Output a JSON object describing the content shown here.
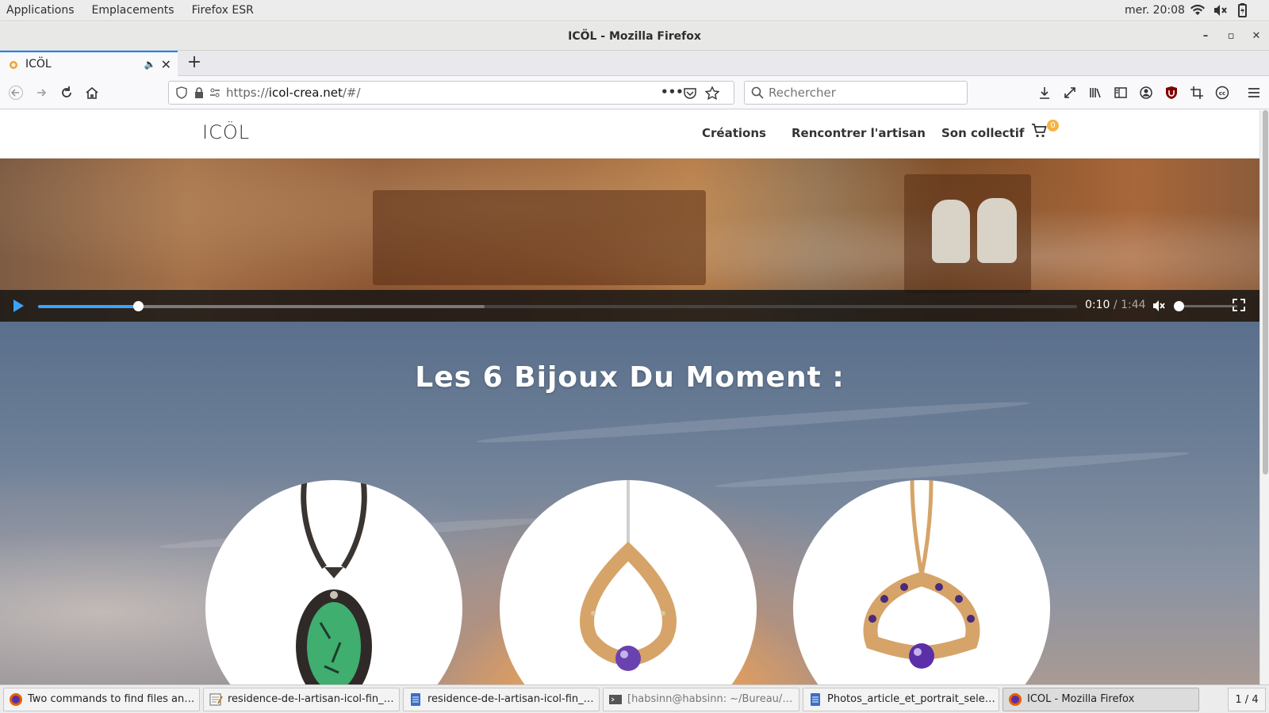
{
  "system_panel": {
    "menus": [
      "Applications",
      "Emplacements",
      "Firefox ESR"
    ],
    "clock": "mer. 20:08"
  },
  "window": {
    "title": "ICÖL - Mozilla Firefox"
  },
  "browser": {
    "tab_title": "ICÖL",
    "url_prefix": "https://",
    "url_domain": "icol-crea.net",
    "url_path": "/#/",
    "search_placeholder": "Rechercher"
  },
  "site": {
    "logo": "ICÖL",
    "nav": [
      "Créations",
      "Rencontrer l'artisan",
      "Son collectif"
    ],
    "cart_count": "0",
    "video": {
      "current_time": "0:10",
      "duration": "/ 1:44",
      "played_fraction": 0.096,
      "buffered_fraction": 0.43
    },
    "headline": "Les 6 Bijoux Du Moment :"
  },
  "taskbar": {
    "items": [
      "Two commands to find files and d...",
      "residence-de-l-artisan-icol-fin_n...",
      "residence-de-l-artisan-icol-fin_n...",
      "[habsinn@habsinn: ~/Bureau/TO...",
      "Photos_article_et_portrait_select...",
      "ICÖL - Mozilla Firefox"
    ],
    "pager": "1 / 4"
  },
  "colors": {
    "accent": "#0a84ff",
    "video_progress": "#3ba3ff",
    "cart_badge": "#f5b342"
  }
}
